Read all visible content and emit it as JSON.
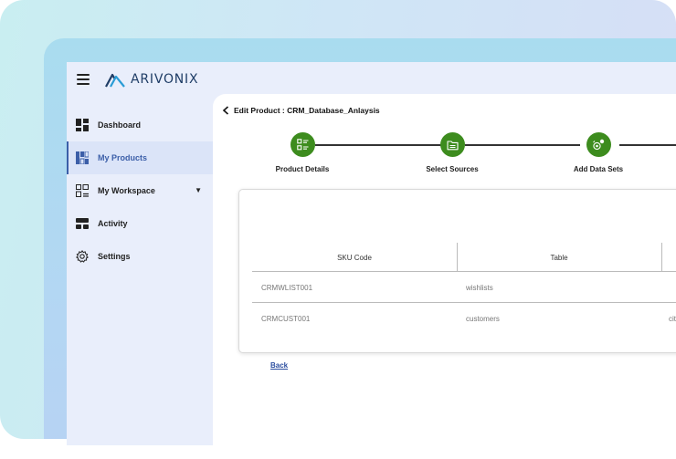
{
  "brand": {
    "name": "ARIVONIX"
  },
  "sidebar": {
    "items": [
      {
        "label": "Dashboard",
        "icon": "dashboard-icon",
        "active": false
      },
      {
        "label": "My Products",
        "icon": "products-grid-icon",
        "active": true
      },
      {
        "label": "My Workspace",
        "icon": "workspace-icon",
        "active": false,
        "caret": "▼"
      },
      {
        "label": "Activity",
        "icon": "activity-icon",
        "active": false
      },
      {
        "label": "Settings",
        "icon": "gear-icon",
        "active": false
      }
    ]
  },
  "page": {
    "title": "Edit Product : CRM_Database_Anlaysis",
    "back_link": "Back"
  },
  "stepper": {
    "color": "#3d8c1e",
    "steps": [
      {
        "label": "Product Details",
        "icon": "list-icon"
      },
      {
        "label": "Select Sources",
        "icon": "folder-icon"
      },
      {
        "label": "Add Data Sets",
        "icon": "dataset-gear-icon"
      }
    ]
  },
  "table": {
    "headers": [
      "SKU Code",
      "Table"
    ],
    "rows": [
      {
        "sku": "CRMWLIST001",
        "table": "wishlists",
        "extra": ""
      },
      {
        "sku": "CRMCUST001",
        "table": "customers",
        "extra": "cit"
      }
    ]
  },
  "colors": {
    "accent": "#3b5ea8",
    "link": "#2d4fa0"
  }
}
